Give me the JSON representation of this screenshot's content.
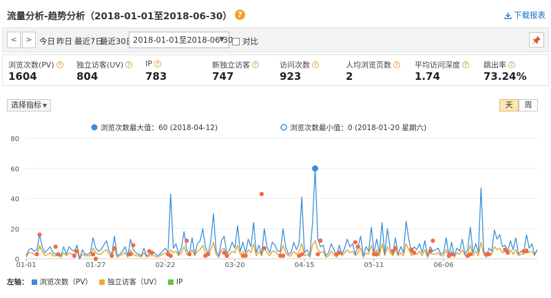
{
  "header": {
    "title": "流量分析-趋势分析（2018-01-01至2018-06-30）",
    "help_glyph": "?",
    "download_label": "下载报表"
  },
  "toolbar": {
    "prev_glyph": "<",
    "next_glyph": ">",
    "quick_ranges": [
      "今日",
      "昨日",
      "最近7日",
      "最近30日"
    ],
    "date_range_value": "2018-01-01至2018-06-30",
    "compare_label": "对比"
  },
  "metrics": [
    {
      "label": "浏览次数(PV)",
      "value": "1604"
    },
    {
      "label": "独立访客(UV)",
      "value": "804"
    },
    {
      "label": "IP",
      "value": "783"
    },
    {
      "label": "新独立访客",
      "value": "747"
    },
    {
      "label": "访问次数",
      "value": "923"
    },
    {
      "label": "人均浏览页数",
      "value": "2"
    },
    {
      "label": "平均访问深度",
      "value": "1.74"
    },
    {
      "label": "跳出率",
      "value": "73.24%"
    }
  ],
  "controls": {
    "metric_select_label": "选择指标",
    "granularity": [
      {
        "label": "天",
        "active": true
      },
      {
        "label": "周",
        "active": false
      }
    ]
  },
  "chart_data": {
    "type": "line",
    "max_annotation": "浏览次数最大值：60 (2018-04-12)",
    "min_annotation": "浏览次数最小值：0 (2018-01-20 星期六)",
    "axis_side_label": "左轴：",
    "ylim": [
      0,
      80
    ],
    "y_ticks": [
      "0",
      "20",
      "40",
      "60",
      "80"
    ],
    "x_ticks": [
      "01-01",
      "01-27",
      "02-22",
      "03-20",
      "04-15",
      "05-11",
      "06-06"
    ],
    "colors": {
      "pv": "#3a8fd6",
      "uv": "#f4a53a",
      "ip": "#6cc13e",
      "highlight": "#f06a43",
      "max_marker": "#3a8fd6"
    },
    "series": [
      {
        "name": "浏览次数（PV）",
        "key": "pv",
        "values": [
          2,
          6,
          7,
          5,
          6,
          16,
          8,
          4,
          6,
          8,
          4,
          3,
          3,
          2,
          8,
          3,
          8,
          6,
          5,
          9,
          0,
          6,
          3,
          3,
          4,
          14,
          7,
          5,
          6,
          9,
          12,
          5,
          3,
          15,
          2,
          3,
          5,
          8,
          2,
          13,
          6,
          4,
          3,
          2,
          7,
          2,
          3,
          4,
          4,
          2,
          3,
          5,
          7,
          4,
          43,
          7,
          10,
          3,
          7,
          18,
          6,
          3,
          14,
          3,
          10,
          12,
          20,
          8,
          3,
          12,
          30,
          5,
          2,
          12,
          15,
          3,
          6,
          11,
          7,
          22,
          5,
          11,
          4,
          13,
          8,
          24,
          4,
          9,
          3,
          20,
          8,
          4,
          11,
          9,
          5,
          5,
          20,
          8,
          3,
          4,
          11,
          6,
          10,
          41,
          4,
          6,
          2,
          23,
          60,
          13,
          8,
          9,
          2,
          4,
          10,
          6,
          2,
          9,
          3,
          7,
          13,
          8,
          10,
          3,
          8,
          15,
          2,
          8,
          5,
          21,
          4,
          13,
          4,
          24,
          3,
          20,
          7,
          3,
          14,
          3,
          8,
          4,
          25,
          13,
          4,
          8,
          6,
          10,
          4,
          12,
          2,
          8,
          5,
          6,
          7,
          3,
          4,
          14,
          2,
          11,
          2,
          7,
          5,
          13,
          3,
          6,
          21,
          4,
          10,
          4,
          47,
          5,
          2,
          7,
          5,
          19,
          13,
          16,
          8,
          9,
          5,
          12,
          6,
          14,
          3,
          5,
          5,
          16,
          7,
          10,
          3,
          6
        ]
      },
      {
        "name": "独立访客（UV）",
        "key": "uv",
        "values": [
          1,
          4,
          4,
          3,
          3,
          9,
          5,
          2,
          3,
          4,
          2,
          2,
          2,
          1,
          4,
          2,
          4,
          3,
          3,
          5,
          0,
          3,
          2,
          2,
          2,
          7,
          4,
          3,
          3,
          5,
          6,
          3,
          2,
          7,
          1,
          2,
          3,
          4,
          1,
          6,
          3,
          2,
          2,
          1,
          4,
          1,
          2,
          2,
          2,
          1,
          2,
          3,
          4,
          2,
          6,
          4,
          5,
          2,
          4,
          8,
          3,
          2,
          6,
          2,
          5,
          6,
          9,
          4,
          2,
          6,
          11,
          3,
          1,
          6,
          7,
          2,
          3,
          5,
          4,
          9,
          3,
          5,
          2,
          6,
          4,
          10,
          2,
          5,
          2,
          8,
          4,
          2,
          5,
          5,
          3,
          3,
          9,
          4,
          2,
          2,
          5,
          3,
          5,
          10,
          2,
          3,
          1,
          9,
          12,
          6,
          4,
          5,
          1,
          2,
          5,
          3,
          1,
          5,
          2,
          4,
          6,
          4,
          5,
          2,
          4,
          7,
          1,
          4,
          3,
          9,
          2,
          6,
          2,
          10,
          2,
          8,
          4,
          2,
          6,
          2,
          4,
          2,
          10,
          6,
          2,
          4,
          3,
          5,
          2,
          6,
          1,
          4,
          3,
          3,
          4,
          2,
          2,
          6,
          1,
          5,
          1,
          4,
          3,
          6,
          2,
          3,
          9,
          2,
          5,
          2,
          11,
          3,
          1,
          4,
          3,
          8,
          6,
          7,
          4,
          5,
          3,
          6,
          3,
          6,
          2,
          3,
          3,
          7,
          4,
          5,
          2,
          6
        ]
      },
      {
        "name": "IP",
        "key": "ip",
        "values": [
          1,
          4,
          4,
          3,
          3,
          8,
          5,
          2,
          3,
          4,
          2,
          2,
          2,
          1,
          4,
          2,
          4,
          3,
          3,
          5,
          0,
          3,
          2,
          2,
          2,
          7,
          4,
          3,
          3,
          5,
          6,
          3,
          2,
          7,
          1,
          2,
          3,
          4,
          1,
          6,
          3,
          2,
          2,
          1,
          4,
          1,
          2,
          2,
          2,
          1,
          2,
          3,
          4,
          2,
          6,
          4,
          5,
          2,
          4,
          8,
          3,
          2,
          6,
          2,
          5,
          6,
          9,
          4,
          2,
          6,
          11,
          3,
          1,
          6,
          7,
          2,
          3,
          5,
          4,
          9,
          3,
          5,
          2,
          6,
          4,
          10,
          2,
          5,
          2,
          8,
          4,
          2,
          5,
          5,
          3,
          3,
          9,
          4,
          2,
          2,
          5,
          3,
          5,
          10,
          2,
          3,
          1,
          9,
          12,
          6,
          4,
          5,
          1,
          2,
          5,
          3,
          1,
          5,
          2,
          4,
          6,
          4,
          5,
          2,
          4,
          7,
          1,
          4,
          3,
          9,
          2,
          6,
          2,
          10,
          2,
          8,
          4,
          2,
          6,
          2,
          4,
          2,
          10,
          6,
          2,
          4,
          3,
          5,
          2,
          6,
          1,
          4,
          3,
          3,
          4,
          2,
          2,
          6,
          1,
          5,
          1,
          4,
          3,
          6,
          2,
          3,
          9,
          2,
          5,
          2,
          11,
          3,
          1,
          4,
          3,
          8,
          6,
          7,
          4,
          5,
          3,
          6,
          3,
          6,
          2,
          3,
          3,
          7,
          4,
          5,
          2,
          6
        ]
      }
    ],
    "weekend_markers": {
      "values": [
        3,
        16,
        8,
        3,
        2,
        5,
        3,
        0,
        2,
        7,
        3,
        9,
        5,
        4,
        3,
        2,
        12,
        3,
        2,
        3,
        4,
        2,
        2,
        2,
        43,
        7,
        2,
        2,
        2,
        3,
        3,
        12,
        3,
        4,
        11,
        8,
        3,
        3,
        5,
        7,
        6,
        4,
        5,
        12,
        2,
        3,
        2,
        3,
        3,
        3,
        6,
        4,
        5,
        5,
        3,
        2,
        2,
        3,
        2,
        3,
        3,
        2,
        3,
        6,
        3,
        4,
        10,
        3,
        2,
        4,
        6,
        4,
        7,
        7
      ]
    },
    "max_point": {
      "x": "2018-04-12",
      "y": 60
    }
  }
}
